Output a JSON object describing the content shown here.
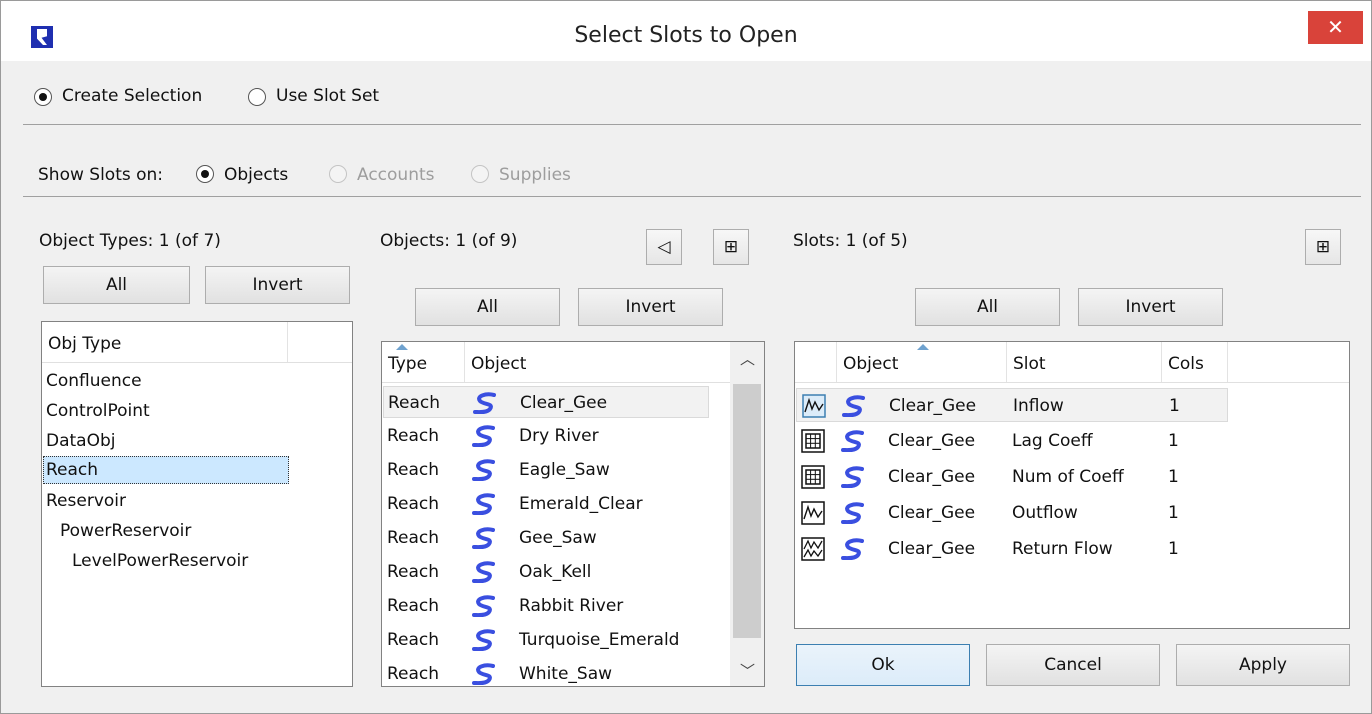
{
  "window": {
    "title": "Select Slots to Open",
    "close_glyph": "✕"
  },
  "mode": {
    "create_selection": "Create Selection",
    "use_slot_set": "Use Slot Set",
    "selected": "create_selection"
  },
  "show_slots": {
    "label": "Show Slots on:",
    "objects": "Objects",
    "accounts": "Accounts",
    "supplies": "Supplies",
    "selected": "objects"
  },
  "object_types": {
    "count_label": "Object Types: 1 (of 7)",
    "all_label": "All",
    "invert_label": "Invert",
    "column": "Obj Type",
    "items": [
      "Confluence",
      "ControlPoint",
      "DataObj",
      "Reach",
      "Reservoir",
      "PowerReservoir",
      "LevelPowerReservoir"
    ],
    "selected": "Reach"
  },
  "objects": {
    "count_label": "Objects: 1 (of 9)",
    "all_label": "All",
    "invert_label": "Invert",
    "collapse_glyph": "◁",
    "menu_glyph": "⊞",
    "columns": [
      "Type",
      "Object"
    ],
    "rows": [
      {
        "type": "Reach",
        "object": "Clear_Gee"
      },
      {
        "type": "Reach",
        "object": "Dry River"
      },
      {
        "type": "Reach",
        "object": "Eagle_Saw"
      },
      {
        "type": "Reach",
        "object": "Emerald_Clear"
      },
      {
        "type": "Reach",
        "object": "Gee_Saw"
      },
      {
        "type": "Reach",
        "object": "Oak_Kell"
      },
      {
        "type": "Reach",
        "object": "Rabbit River"
      },
      {
        "type": "Reach",
        "object": "Turquoise_Emerald"
      },
      {
        "type": "Reach",
        "object": "White_Saw"
      }
    ],
    "reach_icon_color": "#3a4fe0"
  },
  "slots": {
    "count_label": "Slots: 1 (of 5)",
    "all_label": "All",
    "invert_label": "Invert",
    "menu_glyph": "⊞",
    "columns": [
      "Object",
      "Slot",
      "Cols"
    ],
    "rows": [
      {
        "icon": "series-slot-icon",
        "object": "Clear_Gee",
        "slot": "Inflow",
        "cols": "1"
      },
      {
        "icon": "table-slot-icon",
        "object": "Clear_Gee",
        "slot": "Lag Coeff",
        "cols": "1"
      },
      {
        "icon": "table-slot-icon",
        "object": "Clear_Gee",
        "slot": "Num of Coeff",
        "cols": "1"
      },
      {
        "icon": "series-slot-icon",
        "object": "Clear_Gee",
        "slot": "Outflow",
        "cols": "1"
      },
      {
        "icon": "agg-series-slot-icon",
        "object": "Clear_Gee",
        "slot": "Return Flow",
        "cols": "1"
      }
    ]
  },
  "footer": {
    "ok": "Ok",
    "cancel": "Cancel",
    "apply": "Apply"
  }
}
